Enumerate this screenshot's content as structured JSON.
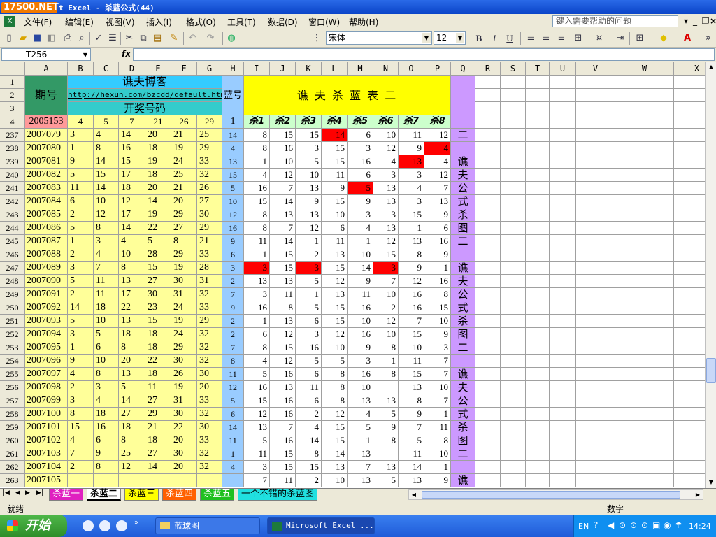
{
  "window": {
    "logo": "17500.NET",
    "title": "t Excel - 杀蓝公式(44)",
    "help_placeholder": "键入需要帮助的问题"
  },
  "menu": [
    "文件(F)",
    "编辑(E)",
    "视图(V)",
    "插入(I)",
    "格式(O)",
    "工具(T)",
    "数据(D)",
    "窗口(W)",
    "帮助(H)"
  ],
  "toolbar": {
    "font": "宋体",
    "size": "12",
    "bold": "B",
    "italic": "I",
    "underline": "U"
  },
  "formula": {
    "name_box": "T256",
    "fx": "fx"
  },
  "columns": [
    "A",
    "B",
    "C",
    "D",
    "E",
    "F",
    "G",
    "H",
    "I",
    "J",
    "K",
    "L",
    "M",
    "N",
    "O",
    "P",
    "Q",
    "R",
    "S",
    "T",
    "U",
    "V",
    "W",
    "X"
  ],
  "header": {
    "blog": "谯夫博客",
    "url": "http://hexun.com/bzcdd/default.html",
    "draw_numbers": "开奖号码",
    "period_label": "期号",
    "blue_label": "蓝号",
    "table_title": "谯 夫 杀 蓝 表 二"
  },
  "row4": {
    "period": "2005153",
    "numbers": [
      "4",
      "5",
      "7",
      "21",
      "26",
      "29"
    ],
    "blue": "1",
    "kill_headers": [
      "杀1",
      "杀2",
      "杀3",
      "杀4",
      "杀5",
      "杀6",
      "杀7",
      "杀8"
    ]
  },
  "rows": [
    {
      "row": "237",
      "period": "2007079",
      "numbers": [
        "3",
        "4",
        "14",
        "20",
        "21",
        "25"
      ],
      "blue": "14",
      "kills": [
        "8",
        "15",
        "15",
        "14",
        "6",
        "10",
        "11",
        "12"
      ]
    },
    {
      "row": "238",
      "period": "2007080",
      "numbers": [
        "1",
        "8",
        "16",
        "18",
        "19",
        "29"
      ],
      "blue": "4",
      "kills": [
        "8",
        "16",
        "3",
        "15",
        "3",
        "12",
        "9",
        "4"
      ]
    },
    {
      "row": "239",
      "period": "2007081",
      "numbers": [
        "9",
        "14",
        "15",
        "19",
        "24",
        "33"
      ],
      "blue": "13",
      "kills": [
        "1",
        "10",
        "5",
        "15",
        "16",
        "4",
        "13",
        "4"
      ]
    },
    {
      "row": "240",
      "period": "2007082",
      "numbers": [
        "5",
        "15",
        "17",
        "18",
        "25",
        "32"
      ],
      "blue": "15",
      "kills": [
        "4",
        "12",
        "10",
        "11",
        "6",
        "3",
        "3",
        "12"
      ]
    },
    {
      "row": "241",
      "period": "2007083",
      "numbers": [
        "11",
        "14",
        "18",
        "20",
        "21",
        "26"
      ],
      "blue": "5",
      "kills": [
        "16",
        "7",
        "13",
        "9",
        "5",
        "13",
        "4",
        "7"
      ]
    },
    {
      "row": "242",
      "period": "2007084",
      "numbers": [
        "6",
        "10",
        "12",
        "14",
        "20",
        "27"
      ],
      "blue": "10",
      "kills": [
        "15",
        "14",
        "9",
        "15",
        "9",
        "13",
        "3",
        "13"
      ]
    },
    {
      "row": "243",
      "period": "2007085",
      "numbers": [
        "2",
        "12",
        "17",
        "19",
        "29",
        "30"
      ],
      "blue": "12",
      "kills": [
        "8",
        "13",
        "13",
        "10",
        "3",
        "3",
        "15",
        "9"
      ]
    },
    {
      "row": "244",
      "period": "2007086",
      "numbers": [
        "5",
        "8",
        "14",
        "22",
        "27",
        "29"
      ],
      "blue": "16",
      "kills": [
        "8",
        "7",
        "12",
        "6",
        "4",
        "13",
        "1",
        "6"
      ]
    },
    {
      "row": "245",
      "period": "2007087",
      "numbers": [
        "1",
        "3",
        "4",
        "5",
        "8",
        "21"
      ],
      "blue": "9",
      "kills": [
        "11",
        "14",
        "1",
        "11",
        "1",
        "12",
        "13",
        "16"
      ]
    },
    {
      "row": "246",
      "period": "2007088",
      "numbers": [
        "2",
        "4",
        "10",
        "28",
        "29",
        "33"
      ],
      "blue": "6",
      "kills": [
        "1",
        "15",
        "2",
        "13",
        "10",
        "15",
        "8",
        "9"
      ]
    },
    {
      "row": "247",
      "period": "2007089",
      "numbers": [
        "3",
        "7",
        "8",
        "15",
        "19",
        "28"
      ],
      "blue": "3",
      "kills": [
        "3",
        "15",
        "3",
        "15",
        "14",
        "3",
        "9",
        "1"
      ]
    },
    {
      "row": "248",
      "period": "2007090",
      "numbers": [
        "5",
        "11",
        "13",
        "27",
        "30",
        "31"
      ],
      "blue": "2",
      "kills": [
        "13",
        "13",
        "5",
        "12",
        "9",
        "7",
        "12",
        "16"
      ]
    },
    {
      "row": "249",
      "period": "2007091",
      "numbers": [
        "2",
        "11",
        "17",
        "30",
        "31",
        "32"
      ],
      "blue": "7",
      "kills": [
        "3",
        "11",
        "1",
        "13",
        "11",
        "10",
        "16",
        "8"
      ]
    },
    {
      "row": "250",
      "period": "2007092",
      "numbers": [
        "14",
        "18",
        "22",
        "23",
        "24",
        "33"
      ],
      "blue": "9",
      "kills": [
        "16",
        "8",
        "5",
        "15",
        "16",
        "2",
        "16",
        "15"
      ]
    },
    {
      "row": "251",
      "period": "2007093",
      "numbers": [
        "5",
        "10",
        "13",
        "15",
        "19",
        "29"
      ],
      "blue": "2",
      "kills": [
        "1",
        "13",
        "6",
        "15",
        "10",
        "12",
        "7",
        "10"
      ]
    },
    {
      "row": "252",
      "period": "2007094",
      "numbers": [
        "3",
        "5",
        "18",
        "18",
        "24",
        "32"
      ],
      "blue": "2",
      "kills": [
        "6",
        "12",
        "3",
        "12",
        "16",
        "10",
        "15",
        "9"
      ]
    },
    {
      "row": "253",
      "period": "2007095",
      "numbers": [
        "1",
        "6",
        "8",
        "18",
        "29",
        "32"
      ],
      "blue": "7",
      "kills": [
        "8",
        "15",
        "16",
        "10",
        "9",
        "8",
        "10",
        "3"
      ]
    },
    {
      "row": "254",
      "period": "2007096",
      "numbers": [
        "9",
        "10",
        "20",
        "22",
        "30",
        "32"
      ],
      "blue": "8",
      "kills": [
        "4",
        "12",
        "5",
        "5",
        "3",
        "1",
        "11",
        "7"
      ]
    },
    {
      "row": "255",
      "period": "2007097",
      "numbers": [
        "4",
        "8",
        "13",
        "18",
        "26",
        "30"
      ],
      "blue": "11",
      "kills": [
        "5",
        "16",
        "6",
        "8",
        "16",
        "8",
        "15",
        "7"
      ]
    },
    {
      "row": "256",
      "period": "2007098",
      "numbers": [
        "2",
        "3",
        "5",
        "11",
        "19",
        "20"
      ],
      "blue": "12",
      "kills": [
        "16",
        "13",
        "11",
        "8",
        "10",
        "",
        "13",
        "10"
      ]
    },
    {
      "row": "257",
      "period": "2007099",
      "numbers": [
        "3",
        "4",
        "14",
        "27",
        "31",
        "33"
      ],
      "blue": "5",
      "kills": [
        "15",
        "16",
        "6",
        "8",
        "13",
        "13",
        "8",
        "7"
      ]
    },
    {
      "row": "258",
      "period": "2007100",
      "numbers": [
        "8",
        "18",
        "27",
        "29",
        "30",
        "32"
      ],
      "blue": "6",
      "kills": [
        "12",
        "16",
        "2",
        "12",
        "4",
        "5",
        "9",
        "1"
      ]
    },
    {
      "row": "259",
      "period": "2007101",
      "numbers": [
        "15",
        "16",
        "18",
        "21",
        "22",
        "30"
      ],
      "blue": "14",
      "kills": [
        "13",
        "7",
        "4",
        "15",
        "5",
        "9",
        "7",
        "11"
      ]
    },
    {
      "row": "260",
      "period": "2007102",
      "numbers": [
        "4",
        "6",
        "8",
        "18",
        "20",
        "33"
      ],
      "blue": "11",
      "kills": [
        "5",
        "16",
        "14",
        "15",
        "1",
        "8",
        "5",
        "8"
      ]
    },
    {
      "row": "261",
      "period": "2007103",
      "numbers": [
        "7",
        "9",
        "25",
        "27",
        "30",
        "32"
      ],
      "blue": "1",
      "kills": [
        "11",
        "15",
        "8",
        "14",
        "13",
        "",
        "11",
        "10"
      ]
    },
    {
      "row": "262",
      "period": "2007104",
      "numbers": [
        "2",
        "8",
        "12",
        "14",
        "20",
        "32"
      ],
      "blue": "4",
      "kills": [
        "3",
        "15",
        "15",
        "13",
        "7",
        "13",
        "14",
        "1"
      ]
    },
    {
      "row": "263",
      "period": "2007105",
      "numbers": [
        "",
        "",
        "",
        "",
        "",
        ""
      ],
      "blue": "",
      "kills": [
        "7",
        "11",
        "2",
        "10",
        "13",
        "5",
        "13",
        "9"
      ]
    }
  ],
  "side_text": "二　谯夫公式杀图二　谯夫公式杀图二　谯夫公式杀图二　谯",
  "highlight_color": "#ff0000",
  "sheet_tabs": [
    "杀蓝一",
    "杀蓝二",
    "杀蓝三",
    "杀蓝四",
    "杀蓝五",
    "一个不错的杀蓝图"
  ],
  "status": {
    "ready": "就绪",
    "mode": "数字"
  },
  "taskbar": {
    "start": "开始",
    "items": [
      "蓝球图",
      "Microsoft Excel ..."
    ],
    "lang": "EN",
    "time": "14:24"
  }
}
